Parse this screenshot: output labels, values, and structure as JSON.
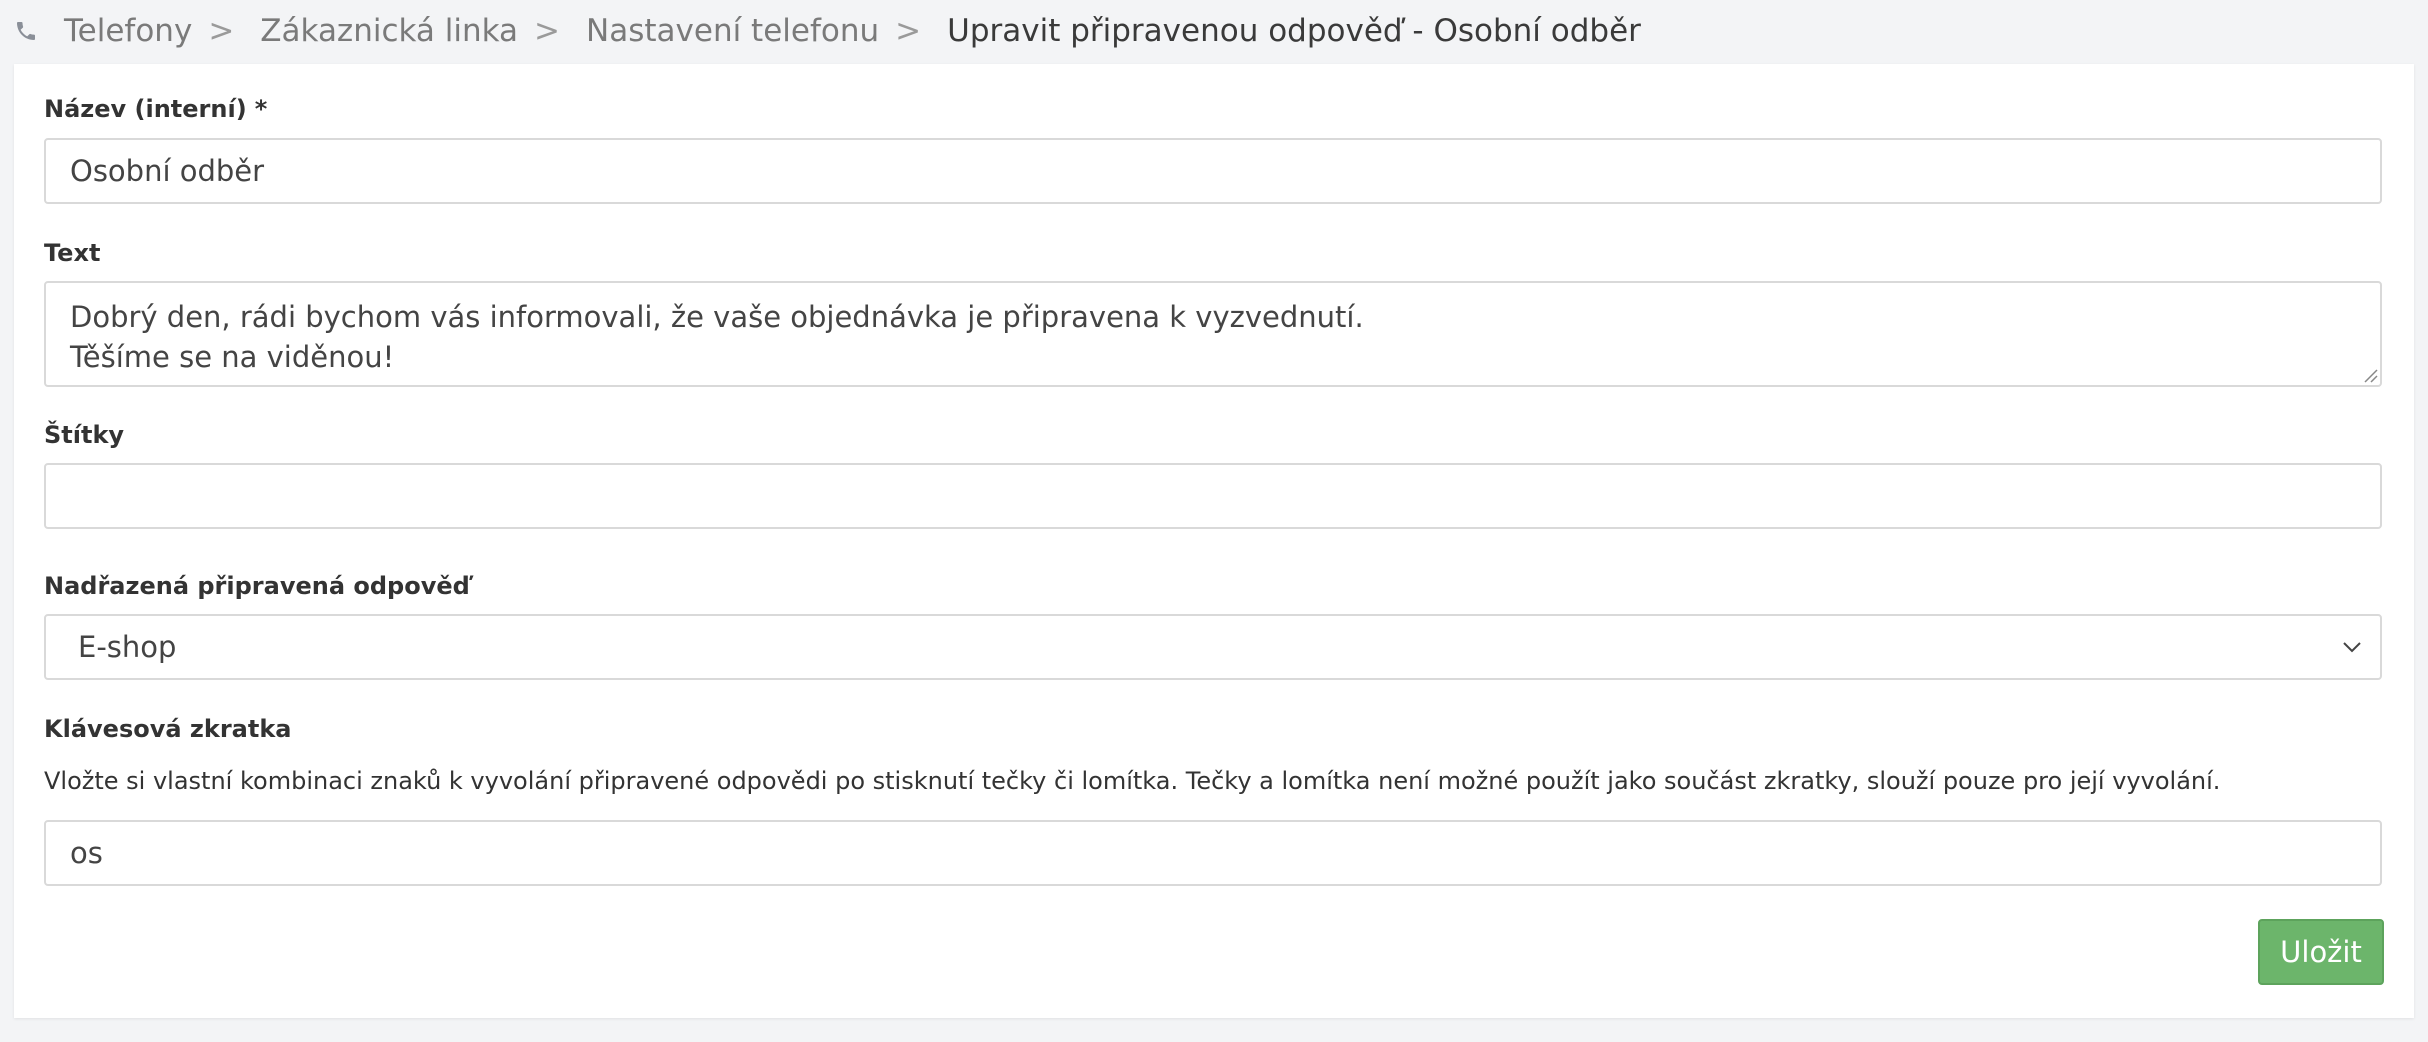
{
  "breadcrumb": {
    "icon": "phone-icon",
    "items": [
      "Telefony",
      "Zákaznická linka",
      "Nastavení telefonu"
    ],
    "separator": ">",
    "current": "Upravit připravenou odpověď - Osobní odběr"
  },
  "form": {
    "name": {
      "label": "Název (interní)",
      "required_mark": "*",
      "value": "Osobní odběr"
    },
    "text": {
      "label": "Text",
      "value": "Dobrý den, rádi bychom vás informovali, že vaše objednávka je připravena k vyzvednutí.\nTěšíme se na viděnou!"
    },
    "tags": {
      "label": "Štítky",
      "value": ""
    },
    "parent": {
      "label": "Nadřazená připravená odpověď",
      "selected": "E-shop"
    },
    "shortcut": {
      "label": "Klávesová zkratka",
      "help": "Vložte si vlastní kombinaci znaků k vyvolání připravené odpovědi po stisknutí tečky či lomítka. Tečky a lomítka není možné použít jako součást zkratky, slouží pouze pro její vyvolání.",
      "value": "os"
    },
    "save_label": "Uložit"
  },
  "colors": {
    "page_bg": "#f3f4f6",
    "save_button": "#6cb56b"
  }
}
